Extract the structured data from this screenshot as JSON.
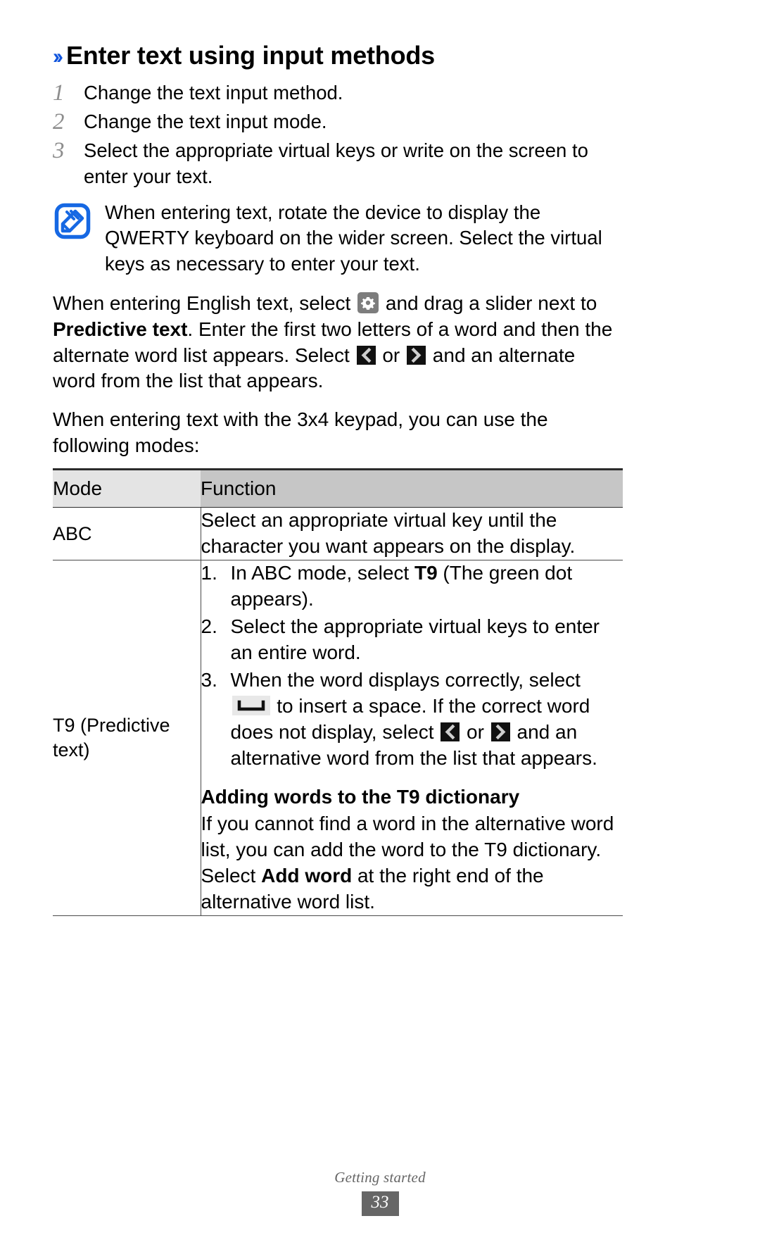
{
  "heading": {
    "marker": "››",
    "title": "Enter text using input methods"
  },
  "steps": [
    {
      "num": "1",
      "text": "Change the text input method."
    },
    {
      "num": "2",
      "text": "Change the text input mode."
    },
    {
      "num": "3",
      "text": "Select the appropriate virtual keys or write on the screen to enter your text."
    }
  ],
  "note": {
    "icon": "note-pen-icon",
    "text": "When entering text, rotate the device to display the QWERTY keyboard on the wider screen. Select the virtual keys as necessary to enter your text."
  },
  "paragraphs": {
    "p1_a": "When entering English text, select ",
    "p1_icon1": "gear-icon",
    "p1_b": " and drag a slider next to ",
    "p1_bold": "Predictive text",
    "p1_c": ". Enter the first two letters of a word and then the alternate word list appears. Select ",
    "p1_icon2": "chevron-left-icon",
    "p1_d": " or ",
    "p1_icon3": "chevron-right-icon",
    "p1_e": " and an alternate word from the list that appears.",
    "p2": "When entering text with the 3x4 keypad, you can use the following modes:"
  },
  "table": {
    "headers": {
      "mode": "Mode",
      "function": "Function"
    },
    "rows": [
      {
        "mode": "ABC",
        "function_text": "Select an appropriate virtual key until the character you want appears on the display."
      },
      {
        "mode": "T9 (Predictive text)",
        "list": [
          {
            "num": "1.",
            "a": "In ABC mode, select ",
            "bold": "T9",
            "b": " (The green dot appears)."
          },
          {
            "num": "2.",
            "a": "Select the appropriate virtual keys to enter an entire word.",
            "bold": "",
            "b": ""
          },
          {
            "num": "3.",
            "a": "When the word displays correctly, select ",
            "icon1": "space-bar-icon",
            "b": " to insert a space. If the correct word does not display, select ",
            "icon2": "chevron-left-icon",
            "c": " or ",
            "icon3": "chevron-right-icon",
            "d": " and an alternative word from the list that appears."
          }
        ],
        "sub_heading": "Adding words to the T9 dictionary",
        "sub_para_a": "If you cannot find a word in the alternative word list, you can add the word to the T9 dictionary. Select ",
        "sub_para_bold": "Add word",
        "sub_para_b": " at the right end of the alternative word list."
      }
    ]
  },
  "footer": {
    "section": "Getting started",
    "page": "33"
  },
  "colors": {
    "accent_blue": "#1155dd",
    "step_num_gray": "#8d8d8d",
    "header_mode_bg": "#e4e4e4",
    "header_func_bg": "#c6c6c6",
    "footer_gray": "#666666"
  }
}
